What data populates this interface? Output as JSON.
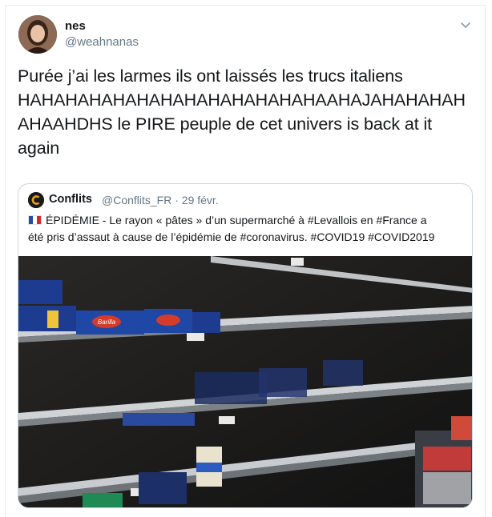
{
  "tweet": {
    "name": "nes",
    "handle": "@weahnanas",
    "text_lines": [
      "Purée j’ai les larmes ils ont laissés les trucs italiens",
      "HAHAHAHAHAHAHAHAHAHAHAHAHAAHAJAHAHAHAH",
      "AHAAHDHS le PIRE peuple de cet univers is back at it",
      "again"
    ]
  },
  "quoted": {
    "name": "Conflits",
    "handle": "@Conflits_FR",
    "separator": "·",
    "date": "29 févr.",
    "text_lines": [
      "ÉPIDÉMIE - Le rayon « pâtes » d’un supermarché à #Levallois en #France a",
      "été pris d’assaut à cause de l’épidémie de #coronavirus. #COVID19 #COVID2019"
    ],
    "pasta_brand": "Barilla"
  },
  "icons": {
    "menu": "chevron-down-icon",
    "flag": "france-flag-icon",
    "logo": "conflits-logo-icon"
  },
  "colors": {
    "primary_text": "#14171a",
    "secondary_text": "#657786",
    "border": "#ccd6dd"
  }
}
